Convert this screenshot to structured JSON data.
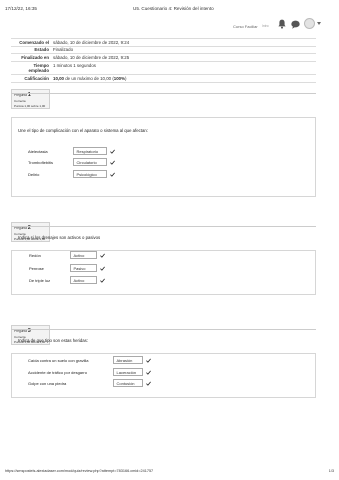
{
  "print_header": {
    "date": "17/12/22, 16:35",
    "title": "U5. Cuestionario 4: Revisión del intento"
  },
  "topbar": {
    "user_name": "Curso Faciliar",
    "user_tag": "Intro"
  },
  "summary": [
    {
      "key": "Comenzado el",
      "value": "sábado, 10 de diciembre de 2022, 9:24"
    },
    {
      "key": "Estado",
      "value": "Finalizado"
    },
    {
      "key": "Finalizado en",
      "value": "sábado, 10 de diciembre de 2022, 9:25"
    },
    {
      "key": "Tiempo empleado",
      "value": "1 minutos 1 segundos"
    },
    {
      "key": "Calificación",
      "value_bold": "10,00",
      "value": " de un máximo de 10,00 (",
      "value_bold2": "100%",
      "value_end": ")"
    }
  ],
  "questions": [
    {
      "label": "Pregunta",
      "number": "1",
      "status": "Correcta",
      "score": "Puntúa 1,00 sobre 1,00",
      "text": "Une el tipo de complicación con el aparato o sistema al que afectan:",
      "rows": [
        {
          "label": "Atelectasia",
          "answer": "Respiratorio"
        },
        {
          "label": "Tromboflebitis",
          "answer": "Circulatorio"
        },
        {
          "label": "Delirio",
          "answer": "Psicológico"
        }
      ]
    },
    {
      "label": "Pregunta",
      "number": "2",
      "status": "Correcta",
      "score": "Puntúa 1,00 sobre 1,00",
      "text": "Indica si los drenajes son activos o pasivos",
      "rows": [
        {
          "label": "Redón",
          "answer": "Activo"
        },
        {
          "label": "Penrose",
          "answer": "Pasivo"
        },
        {
          "label": "De triple luz",
          "answer": "Activo"
        }
      ]
    },
    {
      "label": "Pregunta",
      "number": "3",
      "status": "Correcta",
      "score": "Puntúa 1,00 sobre 1,00",
      "text": "Indica de que tipo son estas heridas:",
      "rows": [
        {
          "label": "Caída contra un suelo con gravilla",
          "answer": "Abrasión"
        },
        {
          "label": "Accidente de tráfico por desgarro",
          "answer": "Laceración"
        },
        {
          "label": "Golpe con una piedra",
          "answer": "Contusión"
        }
      ]
    }
  ],
  "footer": {
    "url": "https://smspostels.alexiadaser.com/mod/quiz/review.php?attempt=783166.cmid=241757",
    "page": "1/3"
  },
  "colors": {
    "check": "#222222",
    "border": "#cccccc",
    "info_bg": "#f3f3f3"
  }
}
